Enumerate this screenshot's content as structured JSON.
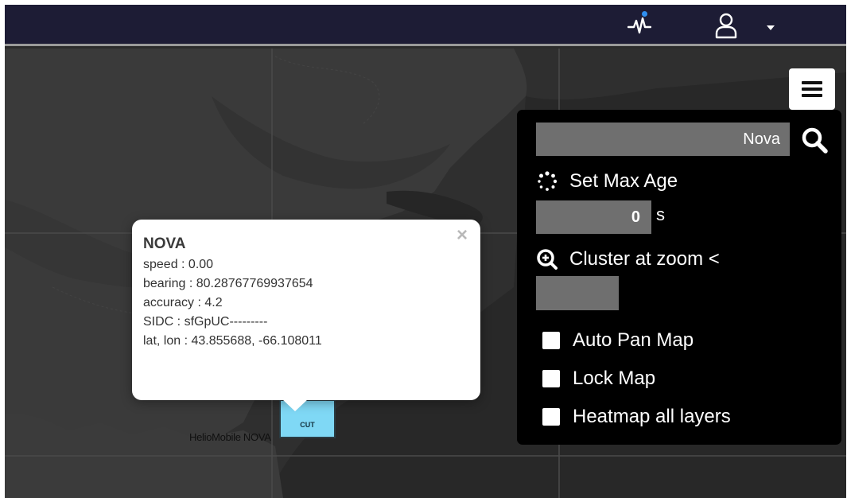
{
  "popup": {
    "title": "NOVA",
    "lines": [
      "speed : 0.00",
      "bearing : 80.28767769937654",
      "accuracy : 4.2",
      "SIDC : sfGpUC---------",
      "lat, lon : 43.855688, -66.108011"
    ],
    "close_glyph": "×"
  },
  "marker": {
    "symbol_text": "CUT",
    "label": "HelioMobile NOVA",
    "fill_color": "#7fd8f5"
  },
  "panel": {
    "search": {
      "value": "Nova"
    },
    "max_age": {
      "label": "Set Max Age",
      "value": "0",
      "unit": "s"
    },
    "cluster": {
      "label": "Cluster at zoom <",
      "value": ""
    },
    "options": [
      {
        "label": "Auto Pan Map",
        "checked": false
      },
      {
        "label": "Lock Map",
        "checked": false
      },
      {
        "label": "Heatmap all layers",
        "checked": false
      }
    ]
  },
  "colors": {
    "navbar": "#1d1c35",
    "panel": "#000000",
    "input": "#6f6f6f",
    "notification": "#2f8ff0"
  },
  "icons": {
    "activity": "activity-pulse-icon",
    "user": "user-icon",
    "caret": "caret-down-icon",
    "menu": "hamburger-menu-icon",
    "search": "search-icon",
    "max_age": "spinner-dots-icon",
    "cluster": "zoom-in-icon"
  }
}
